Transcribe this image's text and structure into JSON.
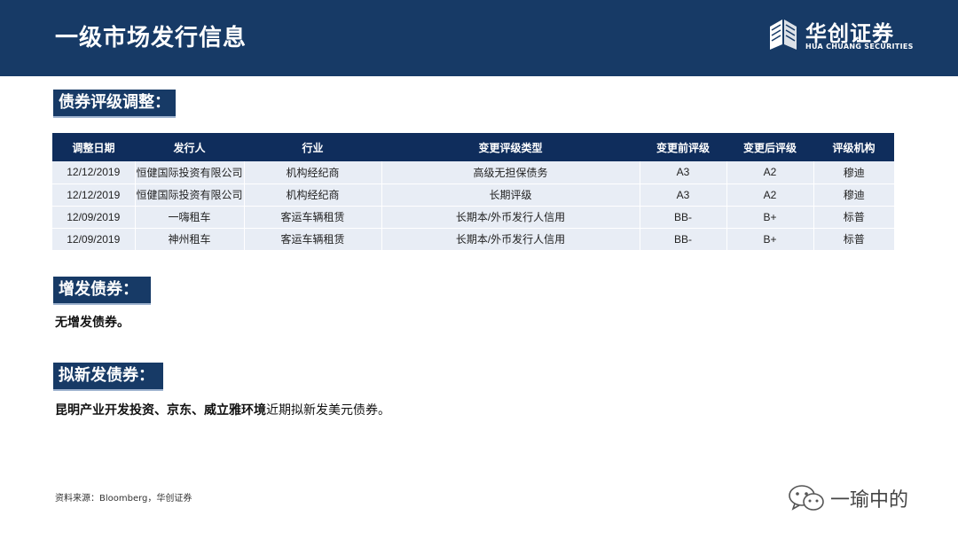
{
  "header": {
    "title": "一级市场发行信息",
    "logo_cn": "华创证券",
    "logo_en": "HUA CHUANG SECURITIES"
  },
  "sections": {
    "rating": "债券评级调整：",
    "new_issue": "增发债券：",
    "planned": "拟新发债券："
  },
  "table": {
    "headers": [
      "调整日期",
      "发行人",
      "行业",
      "变更评级类型",
      "变更前评级",
      "变更后评级",
      "评级机构"
    ],
    "rows": [
      [
        "12/12/2019",
        "恒健国际投资有限公司",
        "机构经纪商",
        "高级无担保债务",
        "A3",
        "A2",
        "穆迪"
      ],
      [
        "12/12/2019",
        "恒健国际投资有限公司",
        "机构经纪商",
        "长期评级",
        "A3",
        "A2",
        "穆迪"
      ],
      [
        "12/09/2019",
        "一嗨租车",
        "客运车辆租赁",
        "长期本/外币发行人信用",
        "BB-",
        "B+",
        "标普"
      ],
      [
        "12/09/2019",
        "神州租车",
        "客运车辆租赁",
        "长期本/外币发行人信用",
        "BB-",
        "B+",
        "标普"
      ]
    ]
  },
  "new_issue_text": "无增发债券。",
  "planned_text": {
    "bold": "昆明产业开发投资、京东、威立雅环境",
    "normal": "近期拟新发美元债券。"
  },
  "source": "资料来源：Bloomberg，华创证券",
  "watermark": "一瑜中的",
  "colors": {
    "header_bg": "#173a66",
    "table_header_bg": "#0f2d5c",
    "table_cell_bg": "#e8edf5"
  }
}
